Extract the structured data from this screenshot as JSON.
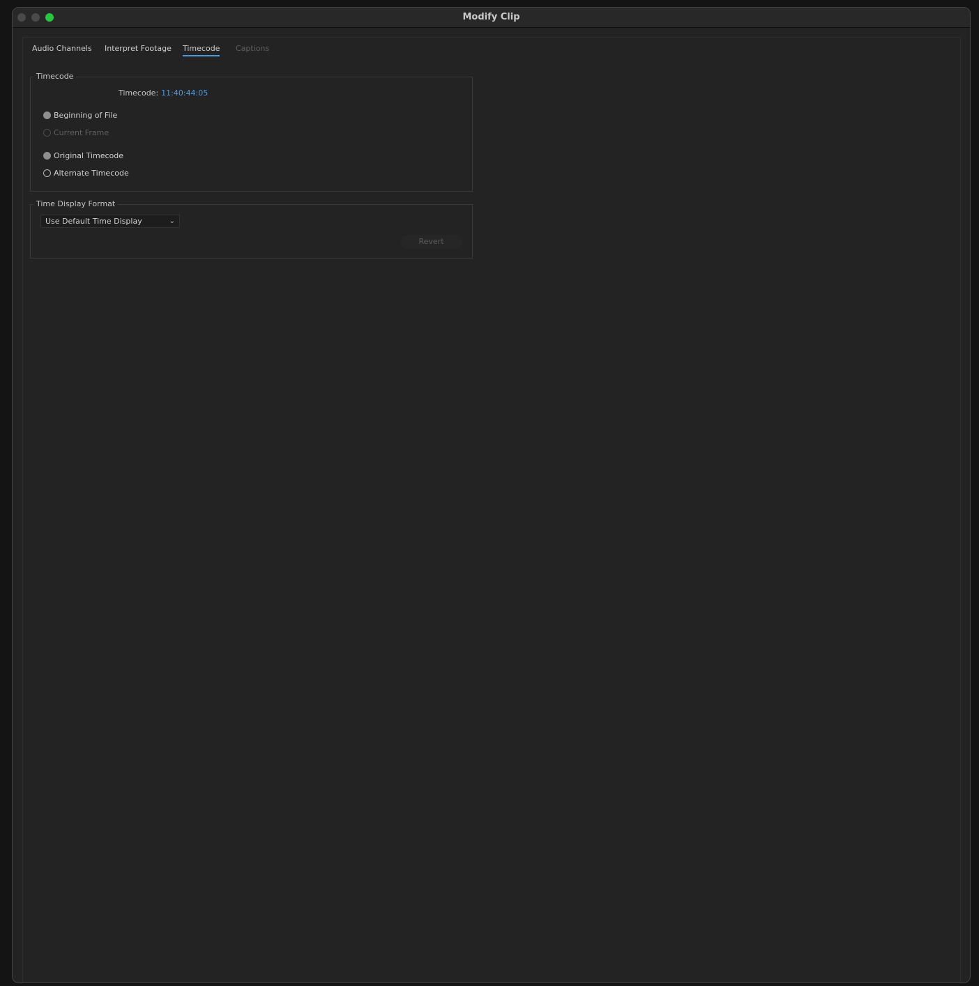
{
  "window": {
    "title": "Modify Clip"
  },
  "tabs": [
    {
      "label": "Audio Channels",
      "state": "normal"
    },
    {
      "label": "Interpret Footage",
      "state": "normal"
    },
    {
      "label": "Timecode",
      "state": "active"
    },
    {
      "label": "Captions",
      "state": "disabled"
    }
  ],
  "timecode_group": {
    "legend": "Timecode",
    "timecode_label": "Timecode:",
    "timecode_value": "11:40:44:05",
    "radios": [
      {
        "label": "Beginning of File",
        "selected": true,
        "disabled": false
      },
      {
        "label": "Current Frame",
        "selected": false,
        "disabled": true
      },
      {
        "label": "Original Timecode",
        "selected": true,
        "disabled": false
      },
      {
        "label": "Alternate Timecode",
        "selected": false,
        "disabled": false
      }
    ]
  },
  "time_display_group": {
    "legend": "Time Display Format",
    "select_value": "Use Default Time Display",
    "revert_label": "Revert"
  },
  "colors": {
    "accent": "#4a9ce6",
    "window_bg": "#232323",
    "maximize": "#27c840"
  }
}
